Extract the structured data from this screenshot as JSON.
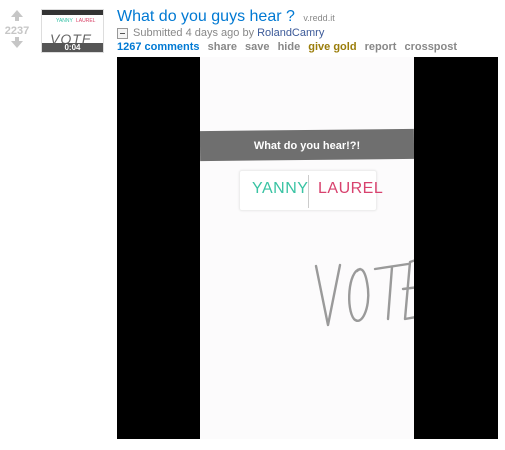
{
  "post": {
    "score": "2237",
    "title": "What do you guys hear ?",
    "domain": "v.redd.it",
    "submitted_prefix": "Submitted 4 days ago by",
    "author": "RolandCamry"
  },
  "thumbnail": {
    "duration": "0:04"
  },
  "buttons": {
    "comments": "1267 comments",
    "share": "share",
    "save": "save",
    "hide": "hide",
    "give_gold": "give gold",
    "report": "report",
    "crosspost": "crosspost"
  },
  "video": {
    "banner": "What do you hear!?!",
    "option_a": "YANNY",
    "option_b": "LAUREL",
    "handwritten": "VOTE"
  },
  "colors": {
    "link": "#0079d3",
    "gold": "#9a7d0a",
    "yanny": "#39c3a3",
    "laurel": "#d8426e"
  }
}
